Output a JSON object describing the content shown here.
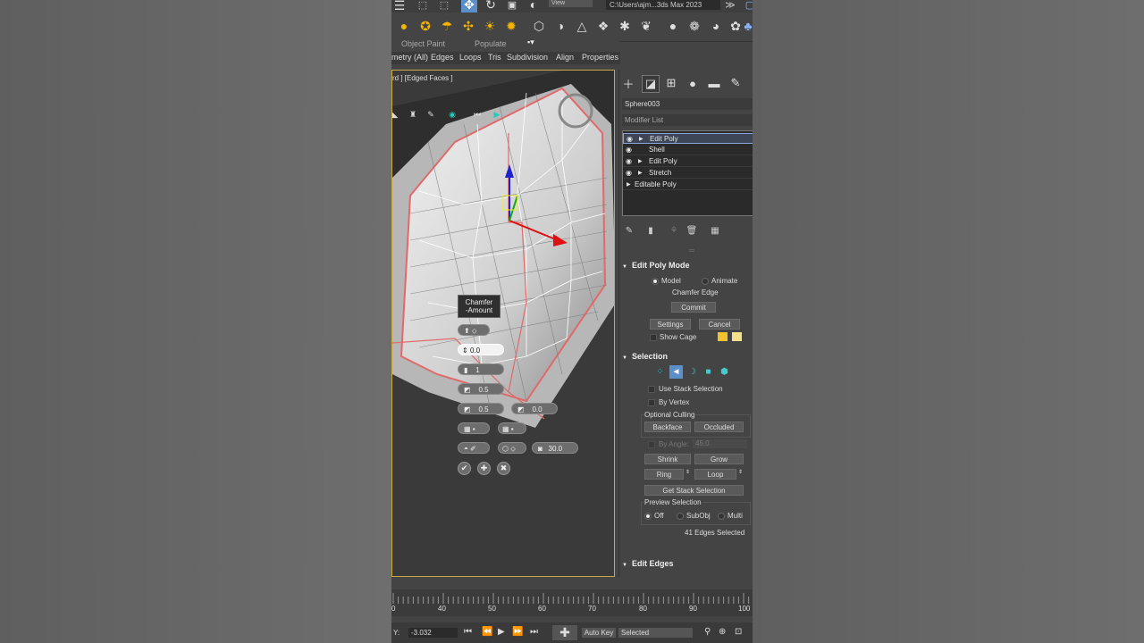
{
  "toolbar": {
    "path": "C:\\Users\\ajm...3ds Max 2023",
    "view": "View",
    "more": "≫"
  },
  "ribbon": {
    "object_paint": "Object Paint",
    "populate": "Populate"
  },
  "ribbon_tabs": [
    "metry (All)",
    "Edges",
    "Loops",
    "Tris",
    "Subdivision",
    "Align",
    "Properties"
  ],
  "viewport": {
    "label": "rd ] [Edged Faces ]",
    "caddy": {
      "title_line1": "Chamfer",
      "title_line2": "-Amount",
      "amount": "0.0",
      "segments": "1",
      "tension": "0.5",
      "depth": "0.5",
      "end_bias": "0.0",
      "angle": "30.0"
    }
  },
  "command_panel": {
    "object_name": "Sphere003",
    "modifier_list": "Modifier List",
    "stack": [
      "Edit Poly",
      "Shell",
      "Edit Poly",
      "Stretch",
      "Editable Poly"
    ],
    "edit_poly_mode": {
      "title": "Edit Poly Mode",
      "model": "Model",
      "animate": "Animate",
      "current_op": "Chamfer Edge",
      "commit": "Commit",
      "settings": "Settings",
      "cancel": "Cancel",
      "show_cage": "Show Cage"
    },
    "selection": {
      "title": "Selection",
      "use_stack": "Use Stack Selection",
      "by_vertex": "By Vertex",
      "optional_culling": "Optional Culling",
      "backface": "Backface",
      "occluded": "Occluded",
      "by_angle": "By Angle:",
      "by_angle_value": "45.0",
      "shrink": "Shrink",
      "grow": "Grow",
      "ring": "Ring",
      "loop": "Loop",
      "get_stack": "Get Stack Selection",
      "preview_selection": "Preview Selection",
      "off": "Off",
      "subobj": "SubObj",
      "multi": "Multi",
      "status": "41 Edges Selected"
    },
    "edit_edges": "Edit Edges"
  },
  "timeline": {
    "ticks": [
      "0",
      "40",
      "50",
      "60",
      "70",
      "80",
      "90",
      "100"
    ]
  },
  "status_bar": {
    "y_label": "Y:",
    "y_value": "-3.032",
    "auto_key": "Auto Key",
    "selected": "Selected"
  },
  "colors": {
    "accent_yellow": "#c9a84a",
    "cage_color1": "#f2c230",
    "cage_color2": "#f2e08a",
    "axis_x": "#d11",
    "axis_y": "#1a1",
    "axis_z": "#22c",
    "sel_icon_bg": "#5b8fc9"
  }
}
